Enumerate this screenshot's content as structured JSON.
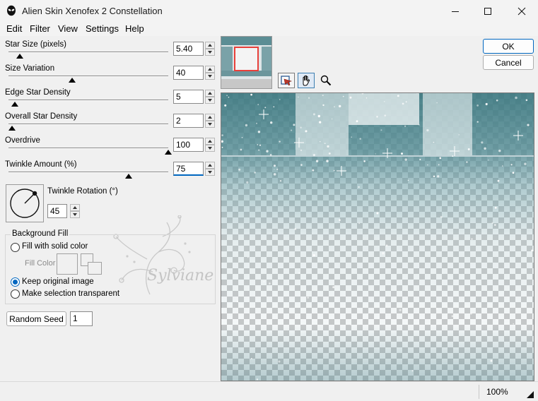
{
  "window": {
    "title": "Alien Skin Xenofex 2 Constellation",
    "icon": "alien-head-icon",
    "controls": [
      "minimize-icon",
      "maximize-icon",
      "close-icon"
    ]
  },
  "menu": [
    "Edit",
    "Filter",
    "View",
    "Settings",
    "Help"
  ],
  "params": [
    {
      "label": "Star Size (pixels)",
      "value": "5.40",
      "slider_fraction": 0.07
    },
    {
      "label": "Size Variation",
      "value": "40",
      "slider_fraction": 0.4
    },
    {
      "label": "Edge Star Density",
      "value": "5",
      "slider_fraction": 0.04
    },
    {
      "label": "Overall Star Density",
      "value": "2",
      "slider_fraction": 0.02
    },
    {
      "label": "Overdrive",
      "value": "100",
      "slider_fraction": 1.0
    },
    {
      "label": "Twinkle Amount (%)",
      "value": "75",
      "slider_fraction": 0.75
    }
  ],
  "twinkle_rotation": {
    "label": "Twinkle Rotation (°)",
    "value": "45",
    "dial_icon": "rotation-dial-icon"
  },
  "background_fill": {
    "title": "Background Fill",
    "options": [
      "Fill with solid color",
      "Keep original image",
      "Make selection transparent"
    ],
    "selected_index": 1,
    "fill_color_label": "Fill Color"
  },
  "random_seed": {
    "button_label": "Random Seed",
    "value": "1"
  },
  "buttons": {
    "ok": "OK",
    "cancel": "Cancel"
  },
  "watermark": {
    "text": "Sylviane"
  },
  "tools": [
    "preview-toggle-icon",
    "hand-icon",
    "zoom-icon"
  ],
  "status": {
    "zoom": "100%"
  },
  "colors": {
    "accent": "#0067c0",
    "teal": "#4f878e",
    "thumb_frame": "#e8403a"
  }
}
